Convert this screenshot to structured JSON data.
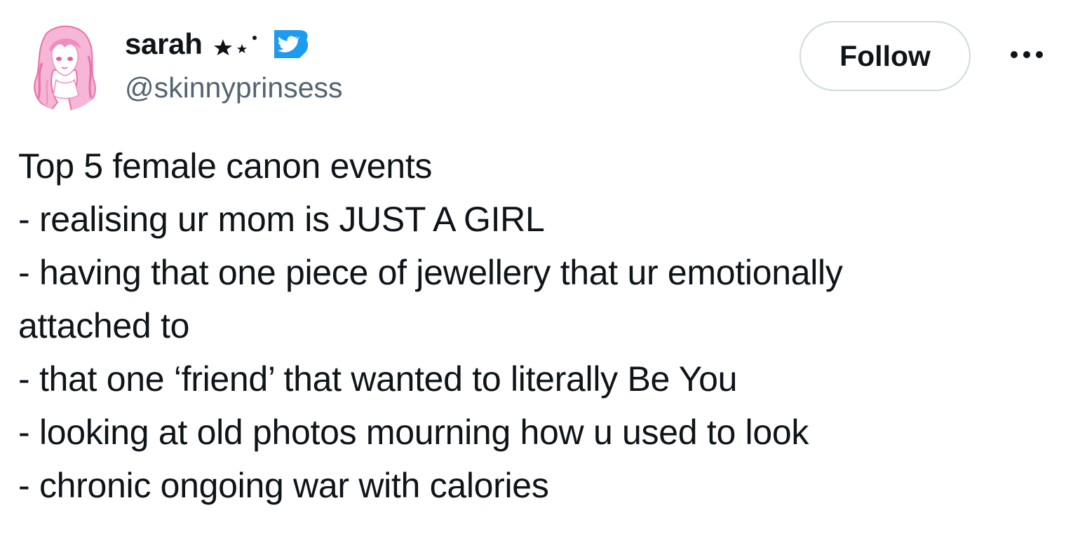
{
  "author": {
    "display_name": "sarah",
    "name_emoji": "★⋆˙",
    "handle": "@skinnyprinsess"
  },
  "actions": {
    "follow_label": "Follow",
    "more_icon": "more-horizontal-icon"
  },
  "tweet": {
    "lines": [
      "Top 5 female canon events",
      "- realising ur mom is JUST A GIRL",
      "- having that one piece of jewellery that ur emotionally",
      "attached to",
      "- that one ‘friend’ that wanted to literally Be You",
      "- looking at old photos mourning how u used to look",
      "- chronic ongoing war with calories"
    ]
  },
  "colors": {
    "text_primary": "#0f1419",
    "text_secondary": "#536471",
    "border": "#cfd9de",
    "verified_blue": "#1d9bf0",
    "avatar_pink": "#f08cbf"
  },
  "icons": {
    "avatar": "anime-girl-avatar",
    "verified": "verified-bird-badge-icon"
  }
}
